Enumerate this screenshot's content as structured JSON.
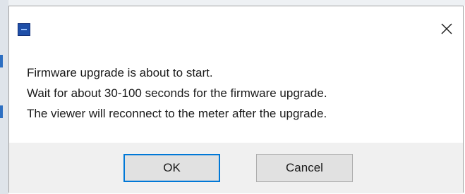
{
  "dialog": {
    "icon": "app-icon",
    "close_icon": "close-icon",
    "message_lines": [
      "Firmware upgrade is about to start.",
      "Wait for about 30-100 seconds for the firmware upgrade.",
      "The viewer will reconnect to the meter after the upgrade."
    ],
    "buttons": {
      "ok_label": "OK",
      "cancel_label": "Cancel"
    },
    "accent_color": "#0078d7",
    "button_bar_color": "#f0f0f0"
  }
}
